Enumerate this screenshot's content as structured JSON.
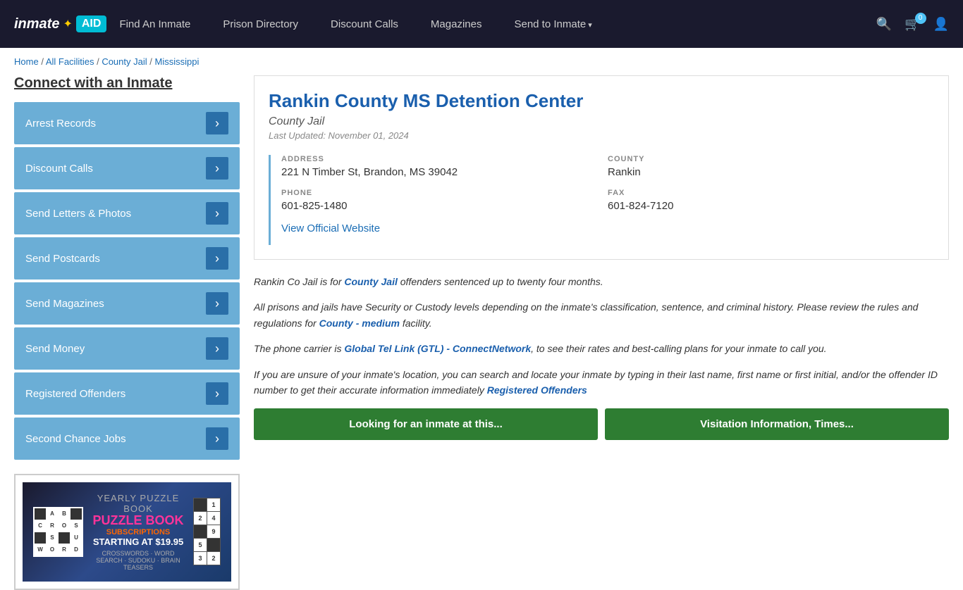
{
  "header": {
    "logo": "inmateAID",
    "logo_part1": "inmate",
    "logo_part2": "AID",
    "nav": [
      {
        "label": "Find An Inmate",
        "hasArrow": false
      },
      {
        "label": "Prison Directory",
        "hasArrow": false
      },
      {
        "label": "Discount Calls",
        "hasArrow": false
      },
      {
        "label": "Magazines",
        "hasArrow": false
      },
      {
        "label": "Send to Inmate",
        "hasArrow": true
      }
    ],
    "cart_count": "0"
  },
  "breadcrumb": {
    "home": "Home",
    "all_facilities": "All Facilities",
    "county_jail": "County Jail",
    "state": "Mississippi"
  },
  "sidebar": {
    "title": "Connect with an Inmate",
    "items": [
      {
        "label": "Arrest Records"
      },
      {
        "label": "Discount Calls"
      },
      {
        "label": "Send Letters & Photos"
      },
      {
        "label": "Send Postcards"
      },
      {
        "label": "Send Magazines"
      },
      {
        "label": "Send Money"
      },
      {
        "label": "Registered Offenders"
      },
      {
        "label": "Second Chance Jobs"
      }
    ]
  },
  "ad": {
    "line1": "YEARLY PUZZLE BOOK",
    "line2": "SUBSCRIPTIONS",
    "line3": "STARTING AT $19.95",
    "line4": "CROSSWORDS · WORD SEARCH · SUDOKU · BRAIN TEASERS"
  },
  "facility": {
    "name": "Rankin County MS Detention Center",
    "type": "County Jail",
    "last_updated": "Last Updated: November 01, 2024",
    "address_label": "ADDRESS",
    "address": "221 N Timber St, Brandon, MS 39042",
    "county_label": "COUNTY",
    "county": "Rankin",
    "phone_label": "PHONE",
    "phone": "601-825-1480",
    "fax_label": "FAX",
    "fax": "601-824-7120",
    "website_link": "View Official Website"
  },
  "description": {
    "p1_before": "Rankin Co Jail is for ",
    "p1_link": "County Jail",
    "p1_after": " offenders sentenced up to twenty four months.",
    "p2_before": "All prisons and jails have Security or Custody levels depending on the inmate's classification, sentence, and criminal history. Please review the rules and regulations for ",
    "p2_link": "County - medium",
    "p2_after": " facility.",
    "p3_before": "The phone carrier is ",
    "p3_link": "Global Tel Link (GTL) - ConnectNetwork",
    "p3_after": ", to see their rates and best-calling plans for your inmate to call you.",
    "p4_before": "If you are unsure of your inmate's location, you can search and locate your inmate by typing in their last name, first name or first initial, and/or the offender ID number to get their accurate information immediately ",
    "p4_link": "Registered Offenders"
  },
  "buttons": {
    "btn1": "Looking for an inmate at this...",
    "btn2": "Visitation Information, Times..."
  }
}
